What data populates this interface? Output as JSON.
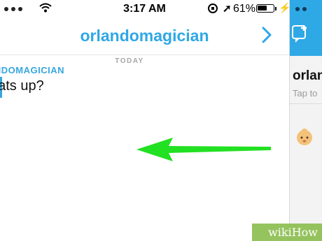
{
  "status_bar": {
    "time": "3:17 AM",
    "battery_percent": "61%",
    "battery_level": 0.61,
    "icons": [
      "signal-dots-icon",
      "wifi-icon",
      "orientation-lock-icon",
      "location-arrow-icon",
      "battery-icon",
      "charging-bolt-icon"
    ]
  },
  "header": {
    "title": "orlandomagician",
    "right_icon": "chevron-right-icon"
  },
  "chat": {
    "day_label": "TODAY",
    "sender": "ANDOMAGICIAN",
    "message": "hats up?"
  },
  "annotation": {
    "arrow_color": "#22e022",
    "arrow_direction": "left"
  },
  "right_panel": {
    "contact_name": "orlan",
    "subtitle": "Tap to",
    "icons": [
      "new-chat-icon",
      "baby-face-emoji-icon"
    ]
  },
  "watermark": {
    "text": "wikiHow"
  },
  "colors": {
    "accent": "#2fa8e6",
    "sender": "#36a7de",
    "arrow": "#22e022"
  }
}
